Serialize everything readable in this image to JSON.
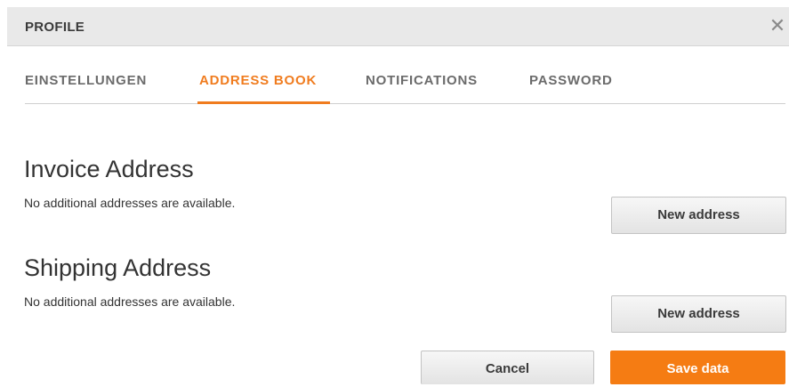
{
  "header": {
    "title": "PROFILE",
    "close_glyph": "✕"
  },
  "tabs": [
    {
      "label": "EINSTELLUNGEN",
      "active": false
    },
    {
      "label": "ADDRESS BOOK",
      "active": true
    },
    {
      "label": "NOTIFICATIONS",
      "active": false
    },
    {
      "label": "PASSWORD",
      "active": false
    }
  ],
  "invoice": {
    "title": "Invoice Address",
    "empty_text": "No additional addresses are available.",
    "new_button": "New address"
  },
  "shipping": {
    "title": "Shipping Address",
    "empty_text": "No additional addresses are available.",
    "new_button": "New address"
  },
  "footer": {
    "cancel_label": "Cancel",
    "save_label": "Save data"
  },
  "colors": {
    "accent": "#f07c1f",
    "save_button": "#f57c13",
    "header_bg": "#e9e9e9"
  },
  "icons": {
    "close": "close-icon"
  }
}
